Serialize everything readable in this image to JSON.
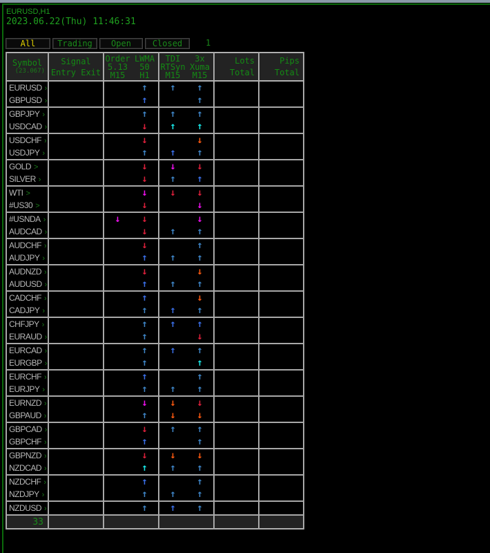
{
  "header": {
    "title": "EURUSD,H1",
    "datetime": "2023.06.22(Thu) 11:46:31"
  },
  "tabs": [
    {
      "label": "All",
      "active": true
    },
    {
      "label": "Trading",
      "active": false
    },
    {
      "label": "Open",
      "active": false
    },
    {
      "label": "Closed",
      "active": false
    }
  ],
  "page_count": "1",
  "columns": {
    "symbol": "Symbol",
    "symbol_sub": "(23.067)",
    "signal": "Signal",
    "signal_sub": "Entry Exit",
    "order": [
      "Order",
      "5.13",
      "M15"
    ],
    "lwma": [
      "LWMA",
      "50",
      "H1"
    ],
    "tdi": [
      "TDI",
      "RTSyn",
      "M15"
    ],
    "xuma": [
      "3x",
      "Xuma",
      "M15"
    ],
    "lots": [
      "Lots",
      "Total"
    ],
    "pips": [
      "Pips",
      "Total"
    ]
  },
  "arrow_styles": {
    "u": {
      "glyph": "↑",
      "color": "#3f86c8"
    },
    "U": {
      "glyph": "↑",
      "color": "#3a6fe8"
    },
    "c": {
      "glyph": "↑",
      "color": "#18e8e8"
    },
    "d": {
      "glyph": "↓",
      "color": "#e0203c"
    },
    "o": {
      "glyph": "↓",
      "color": "#ff5a10"
    },
    "m": {
      "glyph": "↓",
      "color": "#f010f0"
    }
  },
  "rows": [
    {
      "symbol": "EURUSD",
      "marker": "›",
      "order": "",
      "lwma": "u",
      "tdi": "u",
      "xuma": "u"
    },
    {
      "symbol": "GBPUSD",
      "marker": "›",
      "order": "",
      "lwma": "U",
      "tdi": "",
      "xuma": "u"
    },
    {
      "symbol": "GBPJPY",
      "marker": "›",
      "order": "",
      "lwma": "u",
      "tdi": "u",
      "xuma": "u"
    },
    {
      "symbol": "USDCAD",
      "marker": "›",
      "order": "",
      "lwma": "d",
      "tdi": "c",
      "xuma": "c"
    },
    {
      "symbol": "USDCHF",
      "marker": "›",
      "order": "",
      "lwma": "d",
      "tdi": "",
      "xuma": "o"
    },
    {
      "symbol": "USDJPY",
      "marker": "›",
      "order": "",
      "lwma": "u",
      "tdi": "U",
      "xuma": "u"
    },
    {
      "symbol": "GOLD",
      "marker": ">",
      "order": "",
      "lwma": "d",
      "tdi": "m",
      "xuma": "d"
    },
    {
      "symbol": "SILVER",
      "marker": "›",
      "order": "",
      "lwma": "d",
      "tdi": "u",
      "xuma": "U"
    },
    {
      "symbol": "WTI",
      "marker": ">",
      "order": "",
      "lwma": "m",
      "tdi": "d",
      "xuma": "d"
    },
    {
      "symbol": "#US30",
      "marker": ">",
      "order": "",
      "lwma": "d",
      "tdi": "",
      "xuma": "m"
    },
    {
      "symbol": "#USNDA",
      "marker": "›",
      "order": "m",
      "lwma": "d",
      "tdi": "",
      "xuma": "m"
    },
    {
      "symbol": "AUDCAD",
      "marker": "›",
      "order": "",
      "lwma": "d",
      "tdi": "u",
      "xuma": "u"
    },
    {
      "symbol": "AUDCHF",
      "marker": "›",
      "order": "",
      "lwma": "d",
      "tdi": "",
      "xuma": "u"
    },
    {
      "symbol": "AUDJPY",
      "marker": "›",
      "order": "",
      "lwma": "U",
      "tdi": "u",
      "xuma": "u"
    },
    {
      "symbol": "AUDNZD",
      "marker": "›",
      "order": "",
      "lwma": "d",
      "tdi": "",
      "xuma": "o"
    },
    {
      "symbol": "AUDUSD",
      "marker": "›",
      "order": "",
      "lwma": "U",
      "tdi": "u",
      "xuma": "u"
    },
    {
      "symbol": "CADCHF",
      "marker": "›",
      "order": "",
      "lwma": "U",
      "tdi": "",
      "xuma": "o"
    },
    {
      "symbol": "CADJPY",
      "marker": "›",
      "order": "",
      "lwma": "u",
      "tdi": "U",
      "xuma": "u"
    },
    {
      "symbol": "CHFJPY",
      "marker": "›",
      "order": "",
      "lwma": "u",
      "tdi": "U",
      "xuma": "U"
    },
    {
      "symbol": "EURAUD",
      "marker": "›",
      "order": "",
      "lwma": "u",
      "tdi": "",
      "xuma": "d"
    },
    {
      "symbol": "EURCAD",
      "marker": "›",
      "order": "",
      "lwma": "u",
      "tdi": "U",
      "xuma": "u"
    },
    {
      "symbol": "EURGBP",
      "marker": "›",
      "order": "",
      "lwma": "u",
      "tdi": "",
      "xuma": "c"
    },
    {
      "symbol": "EURCHF",
      "marker": "›",
      "order": "",
      "lwma": "U",
      "tdi": "",
      "xuma": "u"
    },
    {
      "symbol": "EURJPY",
      "marker": "›",
      "order": "",
      "lwma": "u",
      "tdi": "u",
      "xuma": "u"
    },
    {
      "symbol": "EURNZD",
      "marker": "›",
      "order": "",
      "lwma": "m",
      "tdi": "o",
      "xuma": "d"
    },
    {
      "symbol": "GBPAUD",
      "marker": "›",
      "order": "",
      "lwma": "u",
      "tdi": "o",
      "xuma": "o"
    },
    {
      "symbol": "GBPCAD",
      "marker": "›",
      "order": "",
      "lwma": "d",
      "tdi": "u",
      "xuma": "u"
    },
    {
      "symbol": "GBPCHF",
      "marker": "›",
      "order": "",
      "lwma": "U",
      "tdi": "",
      "xuma": "u"
    },
    {
      "symbol": "GBPNZD",
      "marker": "›",
      "order": "",
      "lwma": "d",
      "tdi": "o",
      "xuma": "o"
    },
    {
      "symbol": "NZDCAD",
      "marker": "›",
      "order": "",
      "lwma": "c",
      "tdi": "u",
      "xuma": "u"
    },
    {
      "symbol": "NZDCHF",
      "marker": "›",
      "order": "",
      "lwma": "U",
      "tdi": "",
      "xuma": "u"
    },
    {
      "symbol": "NZDJPY",
      "marker": "›",
      "order": "",
      "lwma": "u",
      "tdi": "u",
      "xuma": "u"
    },
    {
      "symbol": "NZDUSD",
      "marker": "›",
      "order": "",
      "lwma": "u",
      "tdi": "U",
      "xuma": "u"
    }
  ],
  "footer": {
    "total_symbols": "33"
  }
}
